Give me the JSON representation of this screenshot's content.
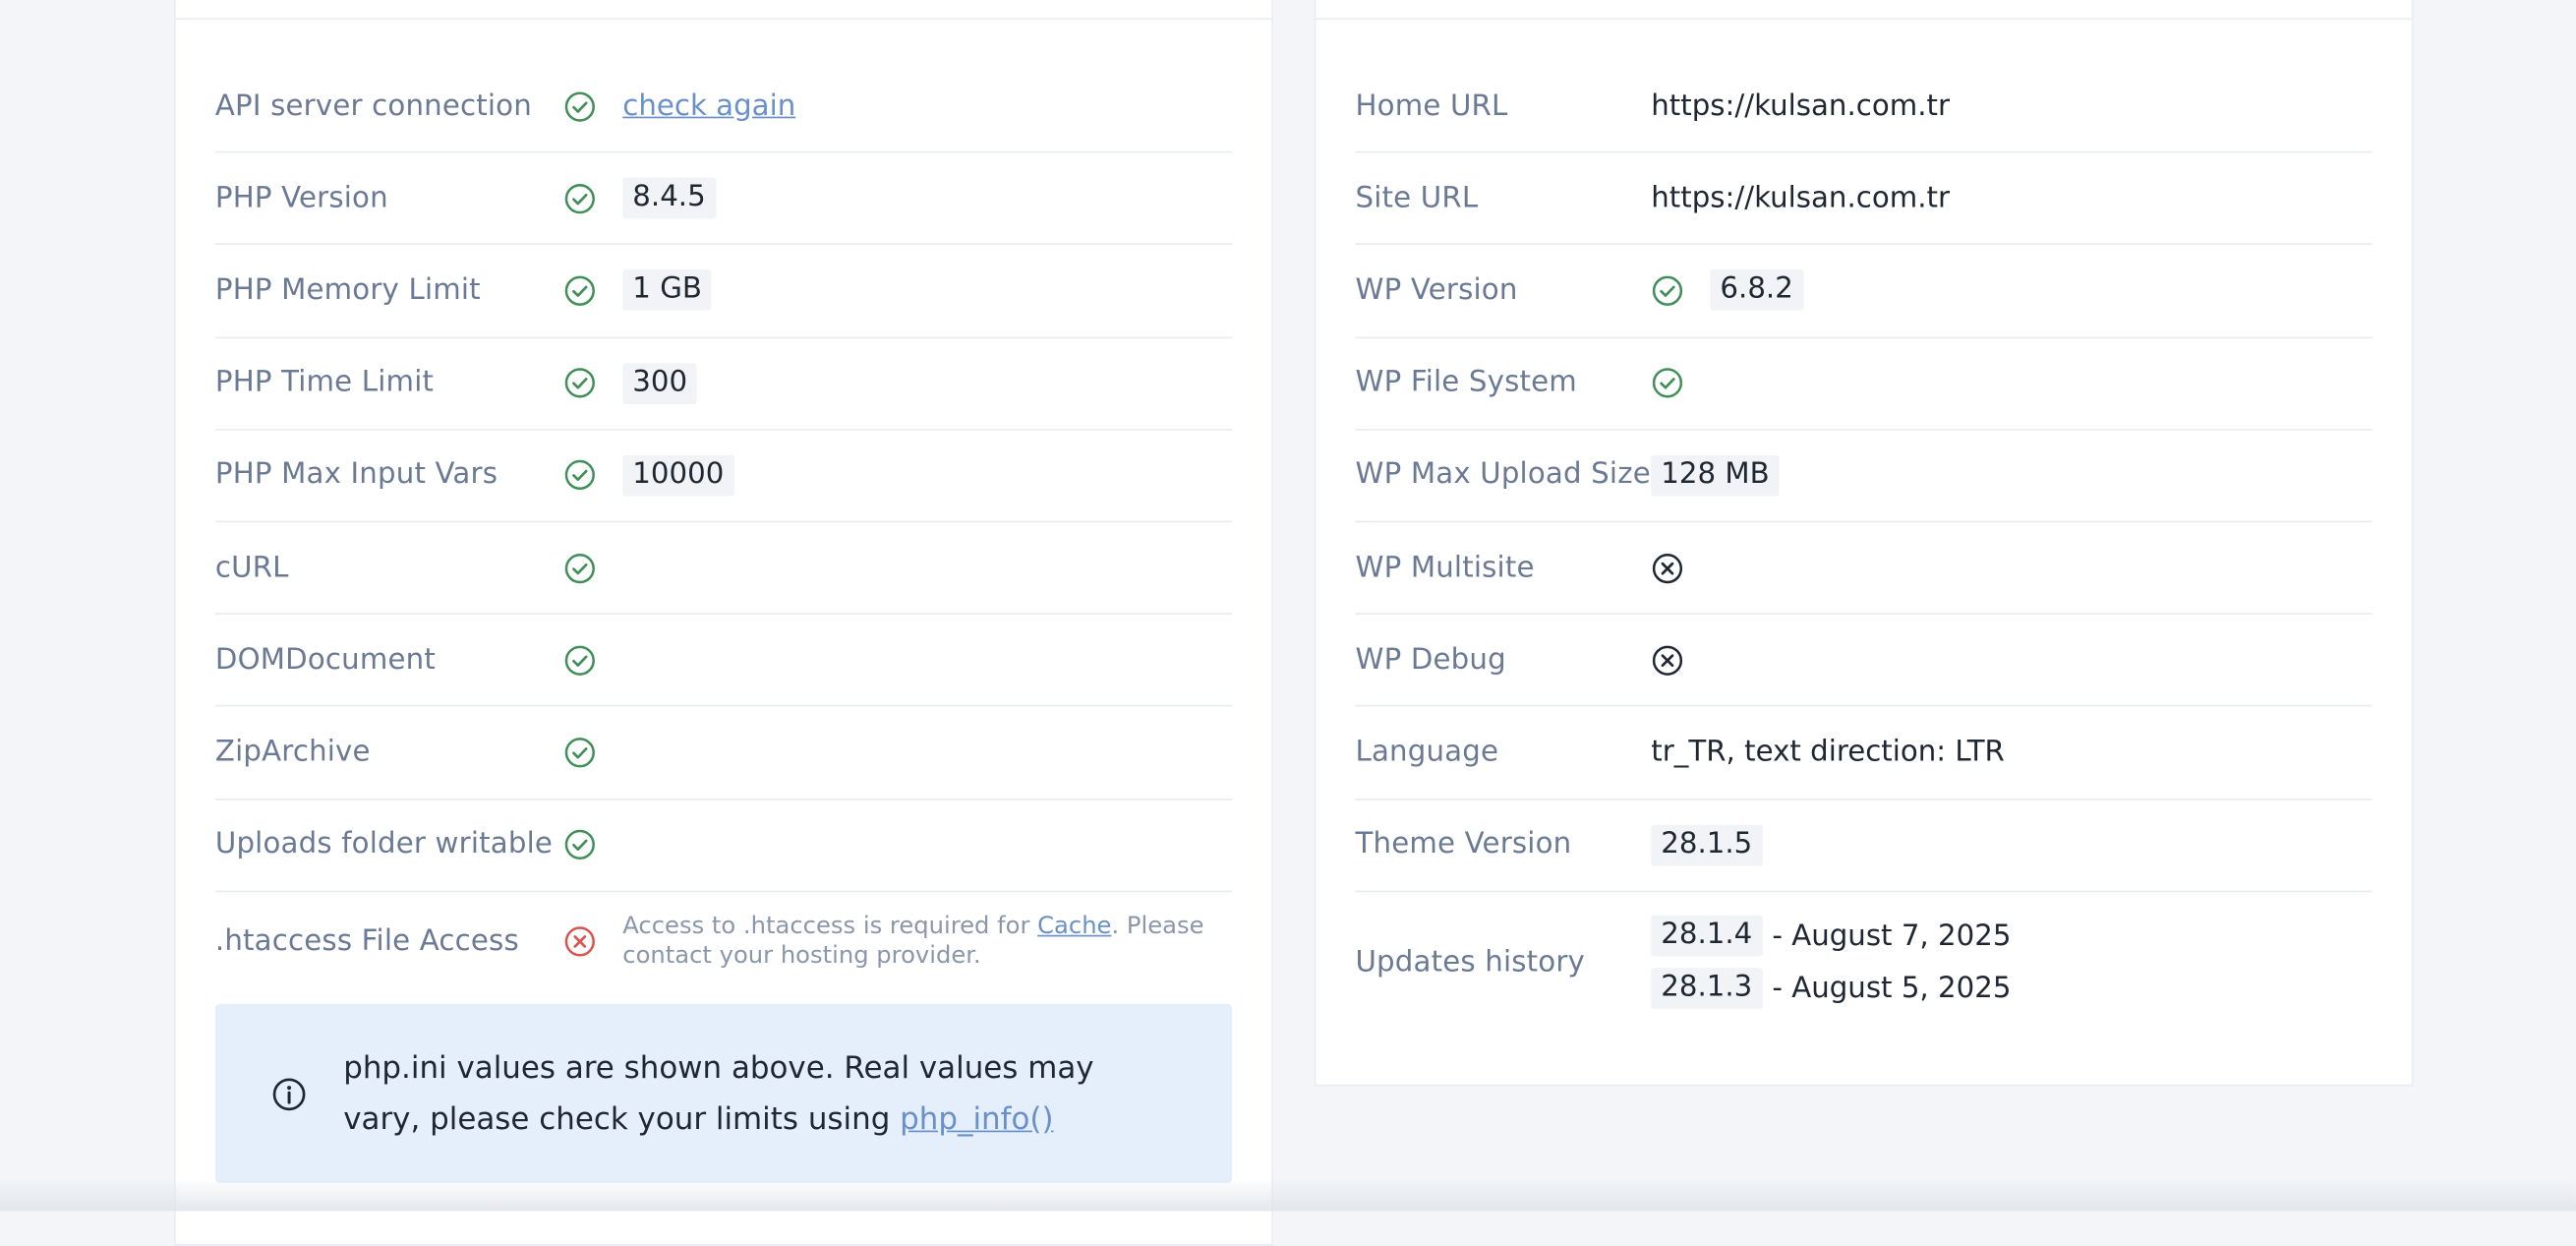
{
  "colors": {
    "ok": "#3f8f57",
    "error": "#d9534f",
    "neutral": "#1f2733",
    "link": "#6a90c9",
    "label": "#6b7a94",
    "info_bg": "#e4effb"
  },
  "left": {
    "rows": [
      {
        "label": "API server connection",
        "status": "check-circle-icon",
        "link": "check again"
      },
      {
        "label": "PHP Version",
        "status": "check-circle-icon",
        "value": "8.4.5"
      },
      {
        "label": "PHP Memory Limit",
        "status": "check-circle-icon",
        "value": "1 GB"
      },
      {
        "label": "PHP Time Limit",
        "status": "check-circle-icon",
        "value": "300"
      },
      {
        "label": "PHP Max Input Vars",
        "status": "check-circle-icon",
        "value": "10000"
      },
      {
        "label": "cURL",
        "status": "check-circle-icon"
      },
      {
        "label": "DOMDocument",
        "status": "check-circle-icon"
      },
      {
        "label": "ZipArchive",
        "status": "check-circle-icon"
      },
      {
        "label": "Uploads folder writable",
        "status": "check-circle-icon"
      },
      {
        "label": ".htaccess File Access",
        "status": "x-circle-icon",
        "note_before": "Access to .htaccess is required for ",
        "note_link": "Cache",
        "note_after": ". Please contact your hosting provider."
      }
    ],
    "info": {
      "icon": "info-circle-icon",
      "text": "php.ini values are shown above. Real values may vary, please check your limits using ",
      "link": "php_info()"
    }
  },
  "right": {
    "rows": [
      {
        "label": "Home URL",
        "value": "https://kulsan.com.tr"
      },
      {
        "label": "Site URL",
        "value": "https://kulsan.com.tr"
      },
      {
        "label": "WP Version",
        "status": "check-circle-icon",
        "value": "6.8.2"
      },
      {
        "label": "WP File System",
        "status": "check-circle-icon"
      },
      {
        "label": "WP Max Upload Size",
        "value": "128 MB"
      },
      {
        "label": "WP Multisite",
        "status": "x-circle-icon"
      },
      {
        "label": "WP Debug",
        "status": "x-circle-icon"
      },
      {
        "label": "Language",
        "value": "tr_TR, text direction: LTR"
      },
      {
        "label": "Theme Version",
        "value": "28.1.5"
      },
      {
        "label": "Updates history",
        "history": [
          {
            "version": "28.1.4",
            "date": "- August 7, 2025"
          },
          {
            "version": "28.1.3",
            "date": "- August 5, 2025"
          }
        ]
      }
    ]
  }
}
